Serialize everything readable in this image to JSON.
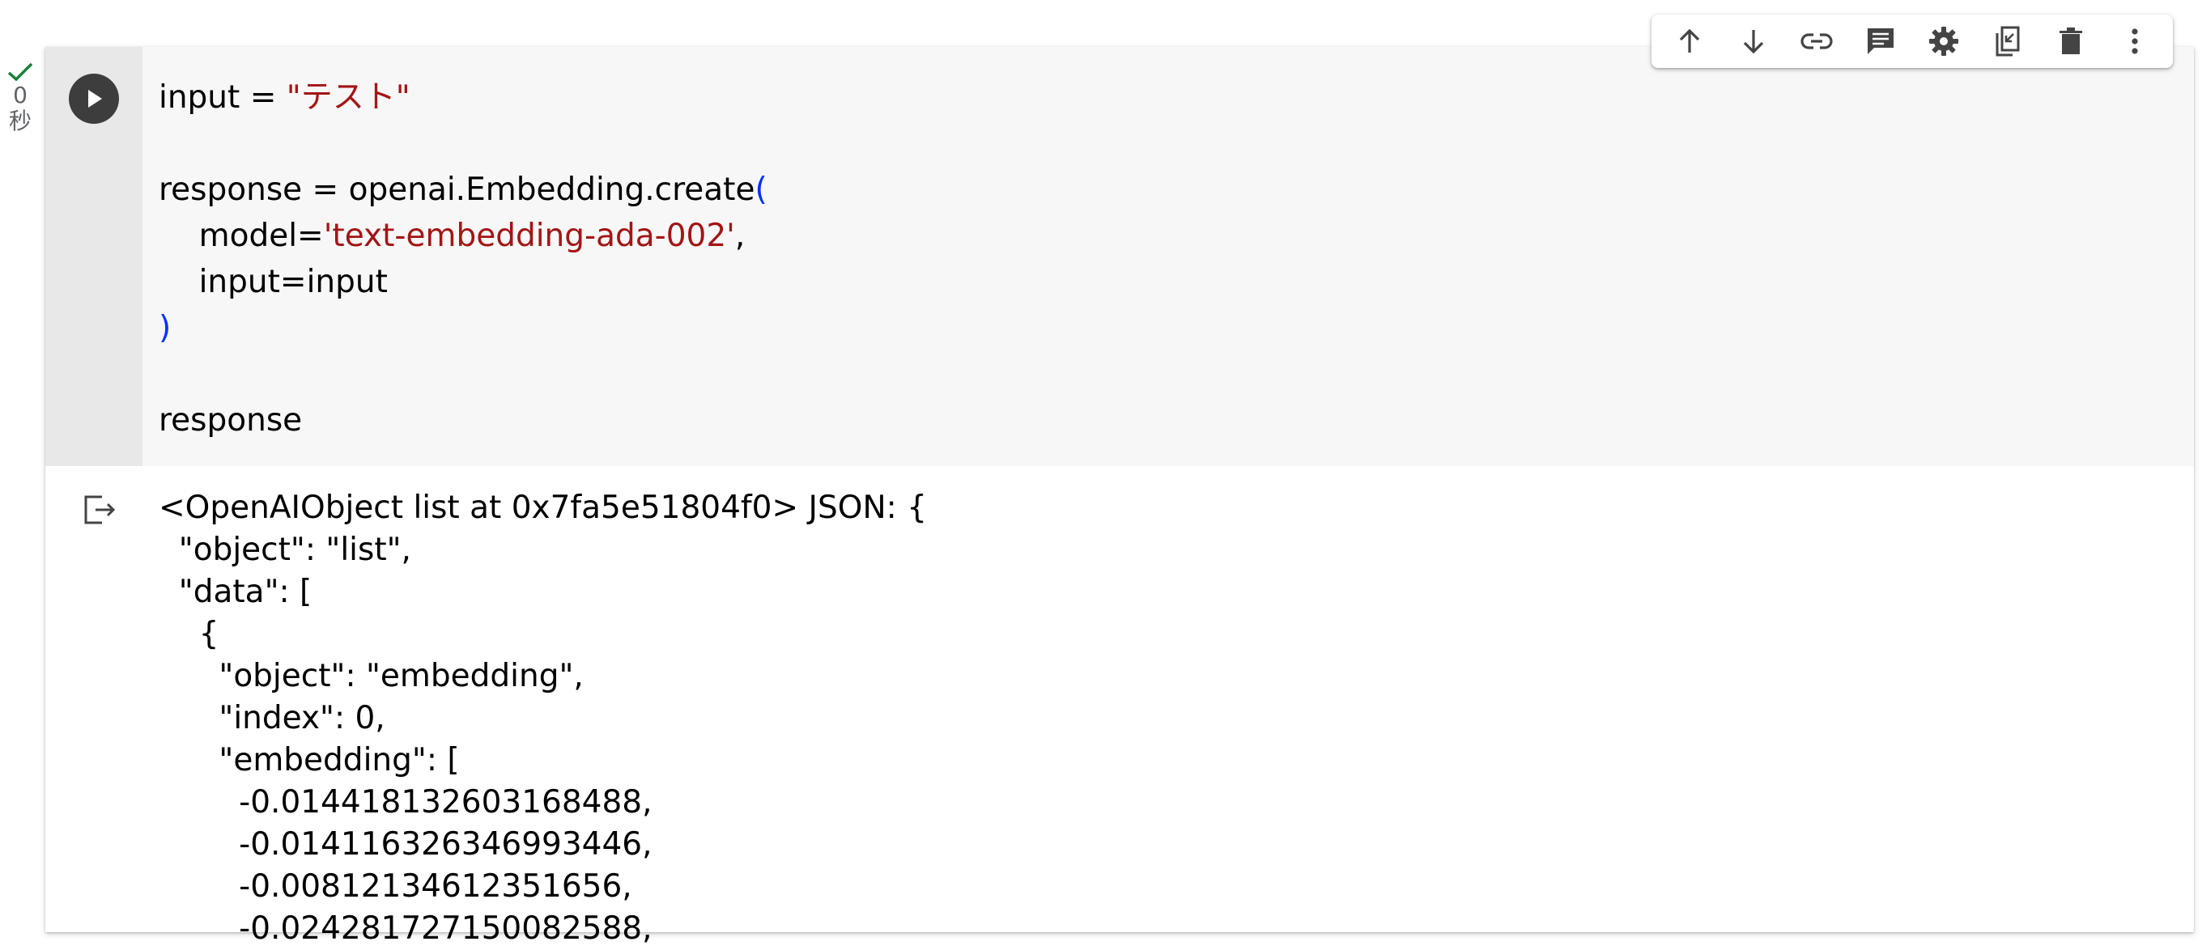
{
  "execution": {
    "seconds": "0",
    "unit": "秒"
  },
  "code": {
    "line1_var": "input = ",
    "line1_str": "\"テスト\"",
    "line3_a": "response = openai.Embedding.create",
    "line3_paren": "(",
    "line4_a": "    model=",
    "line4_str": "'text-embedding-ada-002'",
    "line4_b": ",",
    "line5": "    input=input",
    "line6_paren": ")",
    "line8": "response"
  },
  "output": {
    "lines": [
      "<OpenAIObject list at 0x7fa5e51804f0> JSON: {",
      "  \"object\": \"list\",",
      "  \"data\": [",
      "    {",
      "      \"object\": \"embedding\",",
      "      \"index\": 0,",
      "      \"embedding\": [",
      "        -0.014418132603168488,",
      "        -0.014116326346993446,",
      "        -0.00812134612351656,",
      "        -0.024281727150082588,"
    ]
  },
  "toolbar": {
    "buttons": [
      "move-up-icon",
      "move-down-icon",
      "link-icon",
      "comment-icon",
      "settings-icon",
      "mirror-cell-icon",
      "delete-icon",
      "more-icon"
    ]
  }
}
